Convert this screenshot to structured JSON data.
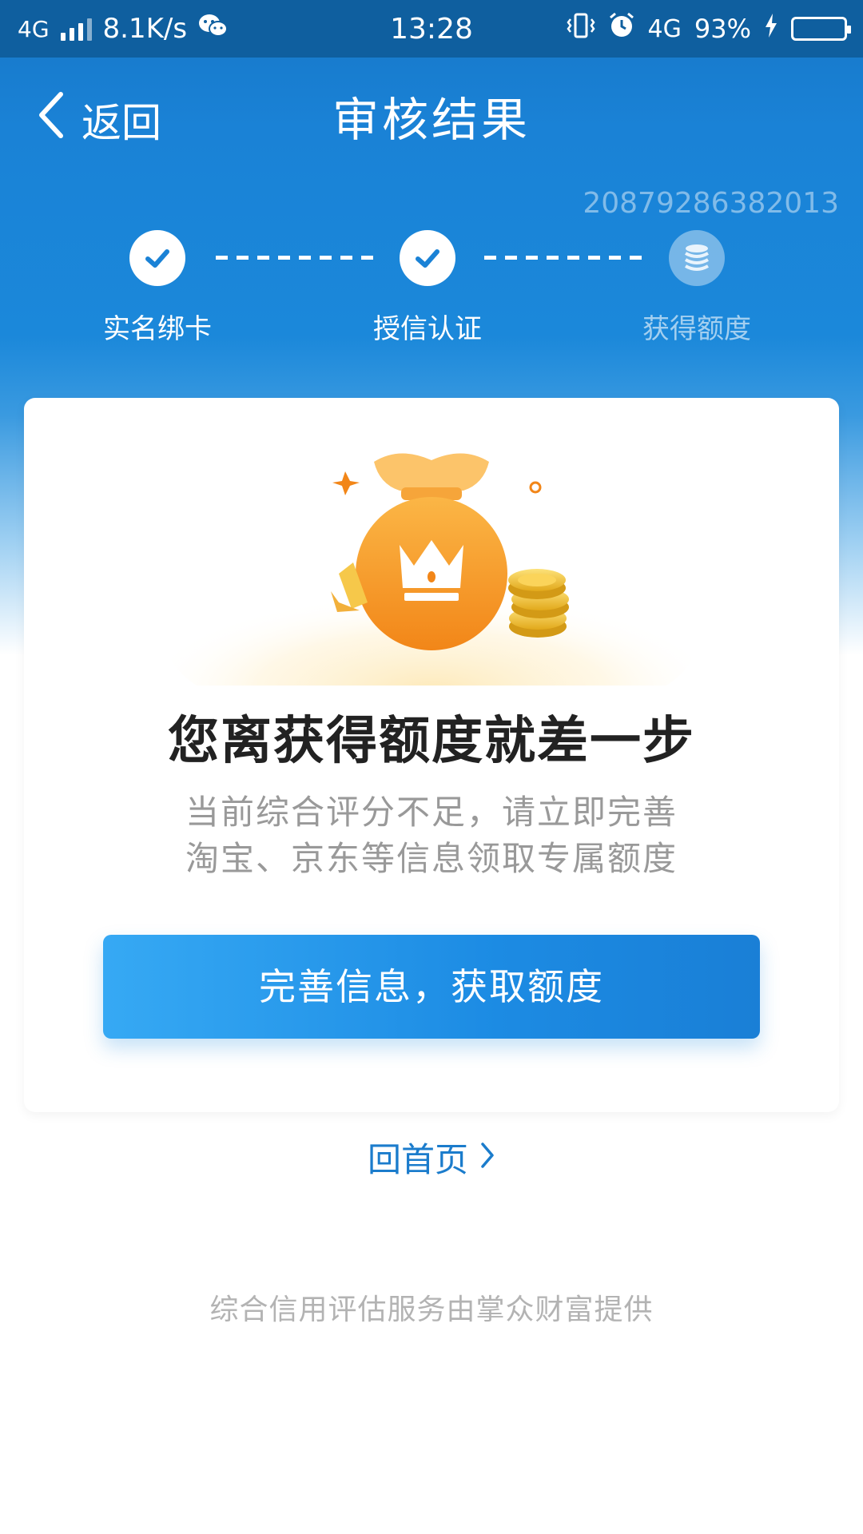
{
  "status_bar": {
    "network": "4G",
    "speed": "8.1K/s",
    "time": "13:28",
    "network2": "4G",
    "battery": "93%",
    "battery_level": 0.93
  },
  "nav": {
    "back_label": "返回",
    "title": "审核结果"
  },
  "order_id": "20879286382013",
  "steps": [
    {
      "label": "实名绑卡",
      "status": "done"
    },
    {
      "label": "授信认证",
      "status": "done"
    },
    {
      "label": "获得额度",
      "status": "pending"
    }
  ],
  "card": {
    "headline": "您离获得额度就差一步",
    "desc_line1": "当前综合评分不足，请立即完善",
    "desc_line2": "淘宝、京东等信息领取专属额度",
    "cta_label": "完善信息，获取额度"
  },
  "home_link": "回首页",
  "footer": "综合信用评估服务由掌众财富提供",
  "colors": {
    "primary": "#1a82d6",
    "link": "#1b7ccc",
    "bag_orange": "#f7931e",
    "coin_gold": "#f2c12e"
  }
}
